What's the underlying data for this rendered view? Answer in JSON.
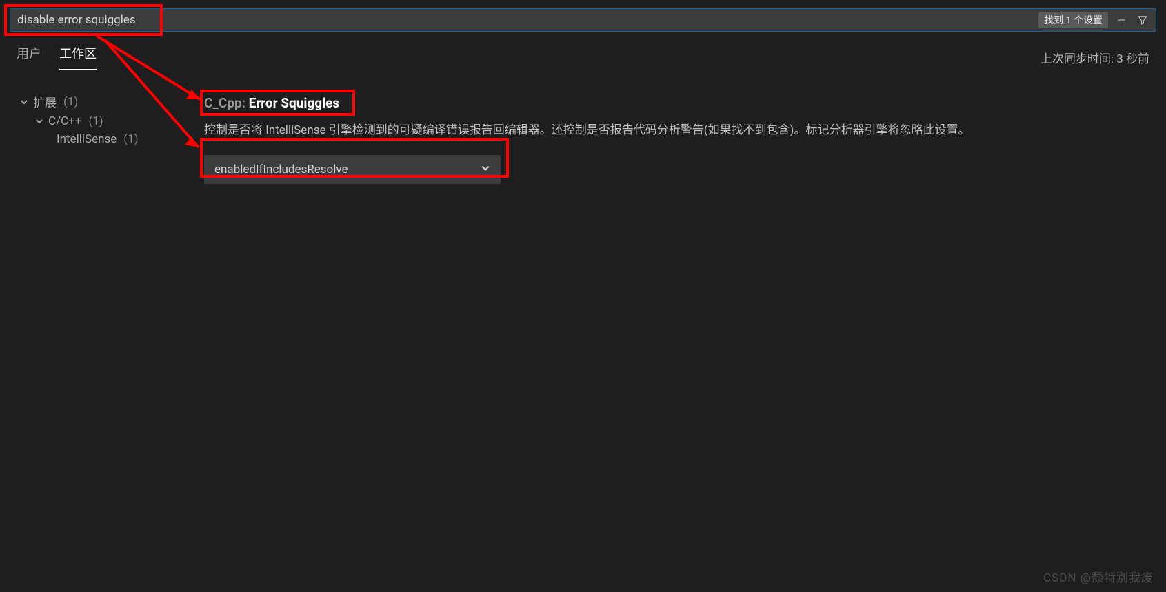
{
  "search": {
    "query": "disable error squiggles",
    "results_badge": "找到 1 个设置"
  },
  "tabs": {
    "user": "用户",
    "workspace": "工作区"
  },
  "sync": {
    "label": "上次同步时间: 3 秒前"
  },
  "tree": {
    "extensions": {
      "label": "扩展",
      "count": "(1)"
    },
    "ccpp": {
      "label": "C/C++",
      "count": "(1)"
    },
    "intellisense": {
      "label": "IntelliSense",
      "count": "(1)"
    }
  },
  "setting": {
    "scope": "C_Cpp: ",
    "name": "Error Squiggles",
    "description": "控制是否将 IntelliSense 引擎检测到的可疑编译错误报告回编辑器。还控制是否报告代码分析警告(如果找不到包含)。标记分析器引擎将忽略此设置。",
    "value": "enabledIfIncludesResolve"
  },
  "icons": {
    "clear_filters": "clear-filters-icon",
    "filter": "filter-icon",
    "chev_down": "chevron-down-icon"
  },
  "annotation": {
    "color": "#ff0000",
    "boxes": [
      "search",
      "title",
      "dropdown"
    ],
    "arrows": 2
  },
  "watermark": "CSDN @颓特别我废"
}
